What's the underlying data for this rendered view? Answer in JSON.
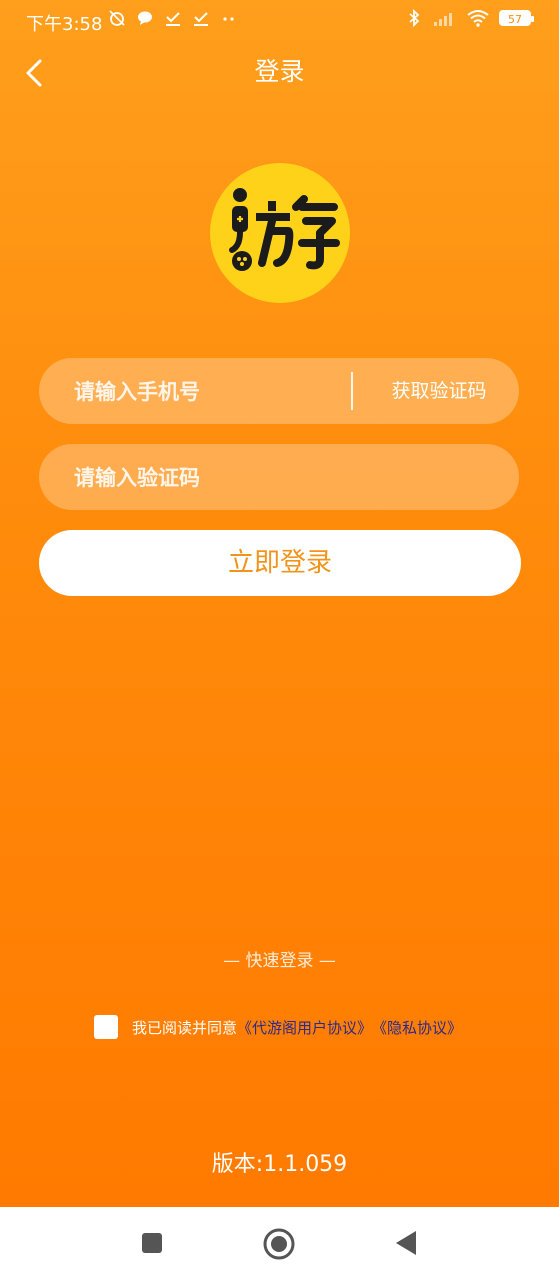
{
  "status_bar": {
    "time": "下午3:58",
    "battery": "57",
    "icons_left": [
      "silent-alarm-icon",
      "chat-bubble-icon",
      "check-download-icon",
      "check-download-icon",
      "more-dots-icon"
    ],
    "icons_right": [
      "bluetooth-icon",
      "signal-icon",
      "wifi-icon",
      "battery-icon"
    ]
  },
  "header": {
    "title": "登录",
    "back_icon": "chevron-left-icon"
  },
  "logo": {
    "text": "游"
  },
  "form": {
    "phone_placeholder": "请输入手机号",
    "get_code_label": "获取验证码",
    "code_placeholder": "请输入验证码",
    "login_label": "立即登录"
  },
  "quick_login": {
    "label": "— 快速登录 —"
  },
  "agreement": {
    "text": "我已阅读并同意",
    "user_agreement": "《代游阁用户协议》",
    "privacy_policy": "《隐私协议》",
    "checked": false
  },
  "version": {
    "text": "版本:1.1.059"
  },
  "nav_bar": {
    "icons": [
      "recent-apps-icon",
      "home-icon",
      "back-triangle-icon"
    ]
  },
  "colors": {
    "accent": "#ff8c0c",
    "logo_bg": "#ffd21a",
    "link": "#2d2a8a"
  }
}
